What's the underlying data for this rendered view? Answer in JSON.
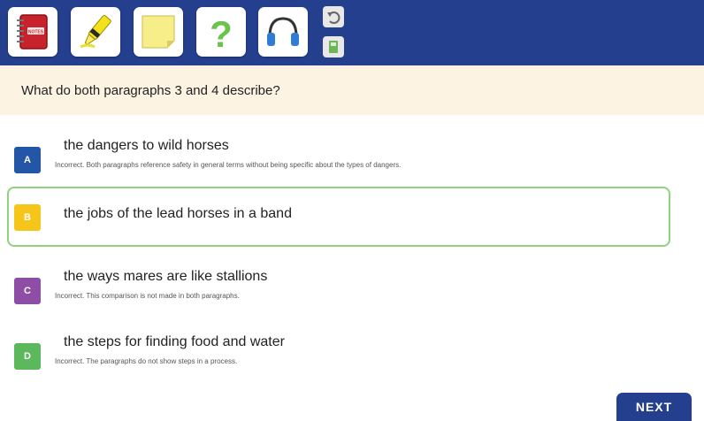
{
  "toolbar": {
    "notebook_label": "NOTES",
    "help_glyph": "?",
    "icons": [
      "notebook-icon",
      "highlighter-icon",
      "sticky-note-icon",
      "help-icon",
      "headphones-icon",
      "undo-icon",
      "save-icon"
    ]
  },
  "question": {
    "text": "What do both paragraphs 3 and 4 describe?"
  },
  "options": [
    {
      "letter": "A",
      "text": "the dangers to wild horses",
      "feedback": "Incorrect. Both paragraphs reference safety in general terms without being specific about the types of dangers.",
      "color": "#2456a8"
    },
    {
      "letter": "B",
      "text": "the jobs of the lead horses in a band",
      "feedback": "",
      "color": "#f5c51a",
      "selected": true
    },
    {
      "letter": "C",
      "text": "the ways mares are like stallions",
      "feedback": "Incorrect. This comparison is not made in both paragraphs.",
      "color": "#8e4ea6"
    },
    {
      "letter": "D",
      "text": "the steps for finding food and water",
      "feedback": "Incorrect. The paragraphs do not show steps in a process.",
      "color": "#5cb85c"
    }
  ],
  "next_label": "NEXT"
}
